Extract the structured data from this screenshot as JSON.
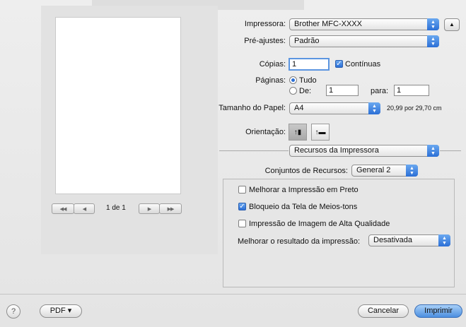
{
  "printer": {
    "label": "Impressora:",
    "value": "Brother MFC-XXXX",
    "expand_icon": "disclosure-triangle-up"
  },
  "presets": {
    "label": "Pré-ajustes:",
    "value": "Padrão"
  },
  "copies": {
    "label": "Cópias:",
    "value": "1",
    "collated_label": "Contínuas",
    "collated_checked": true
  },
  "pages": {
    "label": "Páginas:",
    "all_label": "Tudo",
    "from_label": "De:",
    "from_value": "1",
    "to_label": "para:",
    "to_value": "1",
    "selected": "all"
  },
  "paper_size": {
    "label": "Tamanho do Papel:",
    "value": "A4",
    "dimensions": "20,99 por 29,70 cm"
  },
  "orientation": {
    "label": "Orientação:",
    "selected": "portrait"
  },
  "panel_menu": {
    "value": "Recursos da Impressora"
  },
  "feature_sets": {
    "label": "Conjuntos de Recursos:",
    "value": "General 2"
  },
  "options": {
    "improve_black": {
      "label": "Melhorar a Impressão em Preto",
      "checked": false
    },
    "halftone_lock": {
      "label": "Bloqueio da Tela de Meios-tons",
      "checked": true
    },
    "high_quality": {
      "label": "Impressão de Imagem de Alta Qualidade",
      "checked": false
    },
    "improve_output": {
      "label": "Melhorar o resultado da impressão:",
      "value": "Desativada"
    }
  },
  "preview": {
    "page_count": "1 de 1",
    "first_icon": "◀◀",
    "prev_icon": "◀",
    "next_icon": "▶",
    "last_icon": "▶▶"
  },
  "footer": {
    "help_label": "?",
    "pdf_label": "PDF ▾",
    "cancel_label": "Cancelar",
    "print_label": "Imprimir"
  },
  "colors": {
    "accent": "#2b6fd6",
    "default_button": "#4c8fe0"
  }
}
